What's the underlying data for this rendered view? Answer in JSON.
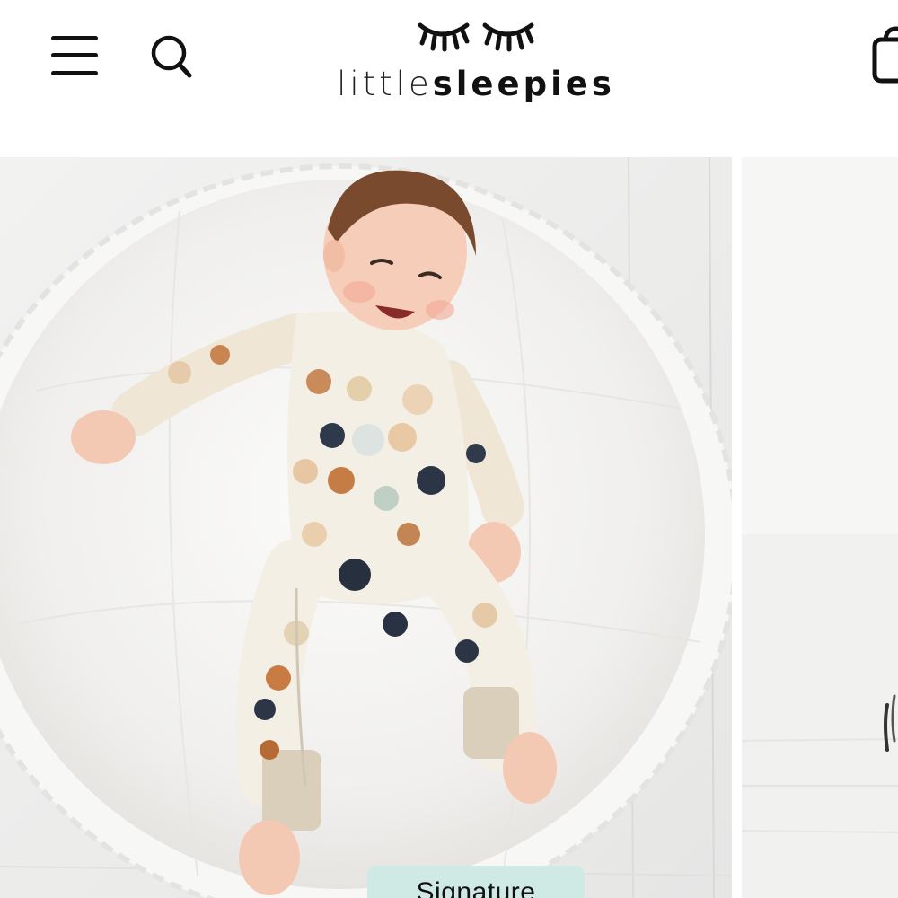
{
  "header": {
    "logo_thin": "little",
    "logo_bold": "sleepies",
    "menu_icon": "hamburger-menu-icon",
    "search_icon": "search-icon",
    "cart_icon": "shopping-bag-icon"
  },
  "carousel": {
    "slides": [
      {
        "image": "baby-in-moon-print-zippy-on-white-quilt",
        "badge": "Signature"
      },
      {
        "image": "partial-next-slide"
      }
    ]
  },
  "colors": {
    "badge_bg": "#cfe9e4",
    "text": "#111111",
    "background": "#ffffff"
  }
}
